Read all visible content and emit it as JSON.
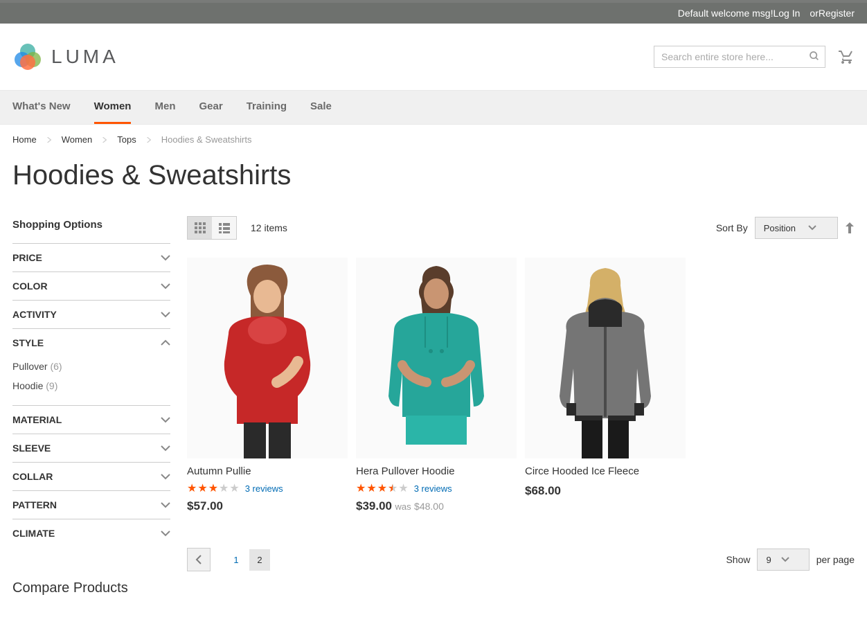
{
  "topbar": {
    "welcome": "Default welcome msg!",
    "login": "Log In",
    "or": "or",
    "register": "Register"
  },
  "logo": {
    "brand": "LUMA"
  },
  "search": {
    "placeholder": "Search entire store here..."
  },
  "nav": {
    "items": [
      "What's New",
      "Women",
      "Men",
      "Gear",
      "Training",
      "Sale"
    ],
    "active_index": 1
  },
  "breadcrumbs": {
    "items": [
      "Home",
      "Women",
      "Tops",
      "Hoodies & Sweatshirts"
    ],
    "current_index": 3
  },
  "page": {
    "title": "Hoodies & Sweatshirts"
  },
  "sidebar": {
    "title": "Shopping Options",
    "filters": [
      {
        "label": "PRICE",
        "expanded": false
      },
      {
        "label": "COLOR",
        "expanded": false
      },
      {
        "label": "ACTIVITY",
        "expanded": false
      },
      {
        "label": "STYLE",
        "expanded": true,
        "options": [
          {
            "name": "Pullover",
            "count": "(6)"
          },
          {
            "name": "Hoodie",
            "count": "(9)"
          }
        ]
      },
      {
        "label": "MATERIAL",
        "expanded": false
      },
      {
        "label": "SLEEVE",
        "expanded": false
      },
      {
        "label": "COLLAR",
        "expanded": false
      },
      {
        "label": "PATTERN",
        "expanded": false
      },
      {
        "label": "CLIMATE",
        "expanded": false
      }
    ],
    "compare_title": "Compare Products"
  },
  "toolbar": {
    "count": "12 items",
    "sort_label": "Sort By",
    "sort_value": "Position",
    "show_label": "Show",
    "show_value": "9",
    "per_page": "per page"
  },
  "products": [
    {
      "name": "Autumn Pullie",
      "rating": 3,
      "reviews": "3 reviews",
      "price": "$57.00",
      "color": "#c62828"
    },
    {
      "name": "Hera Pullover Hoodie",
      "rating": 3.5,
      "reviews": "3 reviews",
      "price": "$39.00",
      "was_label": "was",
      "old_price": "$48.00",
      "color": "#26a69a"
    },
    {
      "name": "Circe Hooded Ice Fleece",
      "rating": 0,
      "reviews": "",
      "price": "$68.00",
      "color": "#757575"
    }
  ],
  "pager": {
    "prev": "‹",
    "pages": [
      "1",
      "2"
    ],
    "current_index": 1
  }
}
